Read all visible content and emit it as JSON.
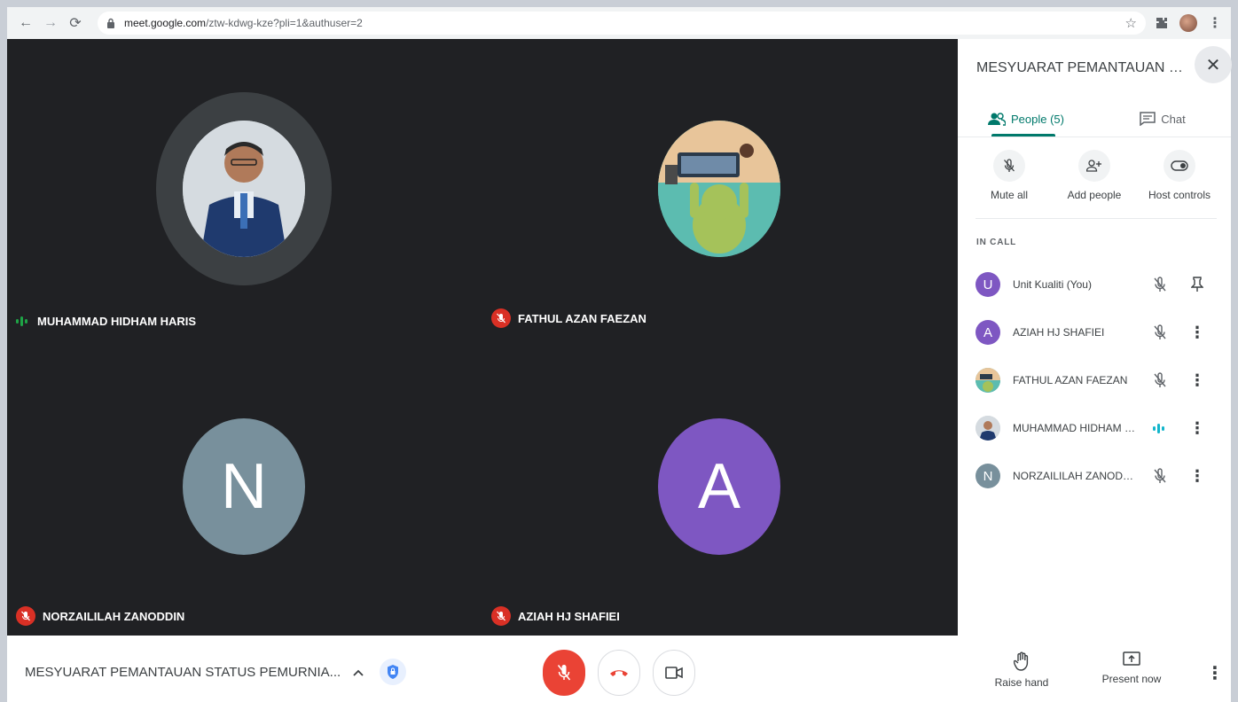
{
  "browser": {
    "url_host": "meet.google.com",
    "url_path": "/ztw-kdwg-kze?pli=1&authuser=2"
  },
  "tiles": [
    {
      "name": "MUHAMMAD HIDHAM HARIS",
      "initial": "",
      "avatar_color": "#8fa7c4",
      "status": "speaking"
    },
    {
      "name": "FATHUL AZAN FAEZAN",
      "initial": "",
      "avatar_color": "#57b5a8",
      "status": "muted"
    },
    {
      "name": "NORZAILILAH ZANODDIN",
      "initial": "N",
      "avatar_color": "#78909c",
      "status": "muted"
    },
    {
      "name": "AZIAH HJ SHAFIEI",
      "initial": "A",
      "avatar_color": "#7e57c2",
      "status": "muted"
    }
  ],
  "panel": {
    "title": "MESYUARAT PEMANTAUAN STAT...",
    "tabs": [
      {
        "label": "People (5)",
        "active": true
      },
      {
        "label": "Chat",
        "active": false
      }
    ],
    "actions": [
      {
        "label": "Mute all"
      },
      {
        "label": "Add people"
      },
      {
        "label": "Host controls"
      }
    ],
    "section_label": "IN CALL",
    "people": [
      {
        "name": "Unit Kualiti (You)",
        "initial": "U",
        "color": "#7e57c2",
        "status": "muted",
        "action": "pin"
      },
      {
        "name": "AZIAH HJ SHAFIEI",
        "initial": "A",
        "color": "#7e57c2",
        "status": "muted",
        "action": "more"
      },
      {
        "name": "FATHUL AZAN FAEZAN",
        "initial": "",
        "color": "#57b5a8",
        "status": "muted",
        "action": "more"
      },
      {
        "name": "MUHAMMAD HIDHAM H...",
        "initial": "",
        "color": "#5c6f8a",
        "status": "speaking",
        "action": "more"
      },
      {
        "name": "NORZAILILAH ZANODDIN",
        "initial": "N",
        "color": "#78909c",
        "status": "muted",
        "action": "more"
      }
    ]
  },
  "bottom": {
    "meeting_title": "MESYUARAT PEMANTAUAN STATUS PEMURNIA...",
    "raise_hand": "Raise hand",
    "present_now": "Present now"
  }
}
